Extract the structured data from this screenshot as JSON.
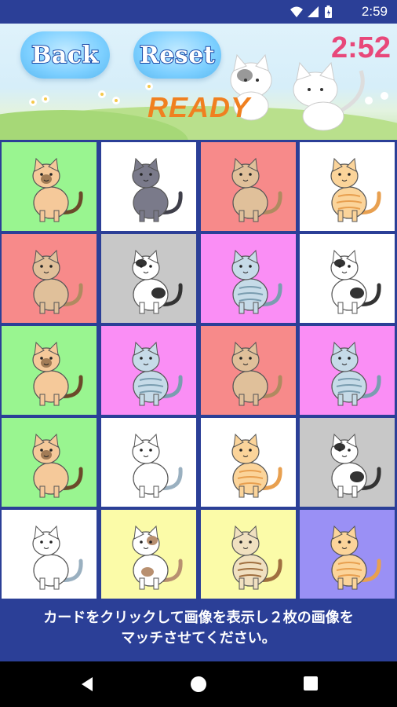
{
  "status_bar": {
    "time": "2:59"
  },
  "header": {
    "back_label": "Back",
    "reset_label": "Reset",
    "timer": "2:52",
    "state": "READY"
  },
  "cards": [
    {
      "bg": "#99f590",
      "cat": "siamese"
    },
    {
      "bg": "#ffffff",
      "cat": "gray"
    },
    {
      "bg": "#f78a8a",
      "cat": "tan"
    },
    {
      "bg": "#ffffff",
      "cat": "orange"
    },
    {
      "bg": "#f78a8a",
      "cat": "tan"
    },
    {
      "bg": "#c8c8c8",
      "cat": "calico"
    },
    {
      "bg": "#fa8ef5",
      "cat": "tabby"
    },
    {
      "bg": "#ffffff",
      "cat": "calico"
    },
    {
      "bg": "#99f590",
      "cat": "siamese"
    },
    {
      "bg": "#fa8ef5",
      "cat": "tabby"
    },
    {
      "bg": "#f78a8a",
      "cat": "tan"
    },
    {
      "bg": "#fa8ef5",
      "cat": "tabby"
    },
    {
      "bg": "#99f590",
      "cat": "siamese"
    },
    {
      "bg": "#ffffff",
      "cat": "persian"
    },
    {
      "bg": "#ffffff",
      "cat": "orange"
    },
    {
      "bg": "#c8c8c8",
      "cat": "calico"
    },
    {
      "bg": "#ffffff",
      "cat": "persian"
    },
    {
      "bg": "#fbfba8",
      "cat": "spotted"
    },
    {
      "bg": "#fbfba8",
      "cat": "longhair"
    },
    {
      "bg": "#9a90f5",
      "cat": "orange"
    }
  ],
  "cat_colors": {
    "siamese": {
      "body": "#f5c99a",
      "accent": "#6b4a2a"
    },
    "gray": {
      "body": "#7a7a8a",
      "accent": "#3f3f4a"
    },
    "tan": {
      "body": "#e0c09a",
      "accent": "#b08a60"
    },
    "orange": {
      "body": "#fbd49a",
      "accent": "#e8a050"
    },
    "calico": {
      "body": "#ffffff",
      "accent": "#333333"
    },
    "tabby": {
      "body": "#c6dbe8",
      "accent": "#7a9db0"
    },
    "persian": {
      "body": "#ffffff",
      "accent": "#9ab0c0"
    },
    "spotted": {
      "body": "#ffffff",
      "accent": "#b89070"
    },
    "longhair": {
      "body": "#f0e0c0",
      "accent": "#a07040"
    }
  },
  "footer": {
    "line1": "カードをクリックして画像を表示し２枚の画像を",
    "line2": "マッチさせてください。"
  },
  "icons": [
    "wifi-icon",
    "signal-icon",
    "battery-icon",
    "back-nav-icon",
    "home-nav-icon",
    "recents-nav-icon",
    "cloud-icon",
    "cat-icon"
  ]
}
